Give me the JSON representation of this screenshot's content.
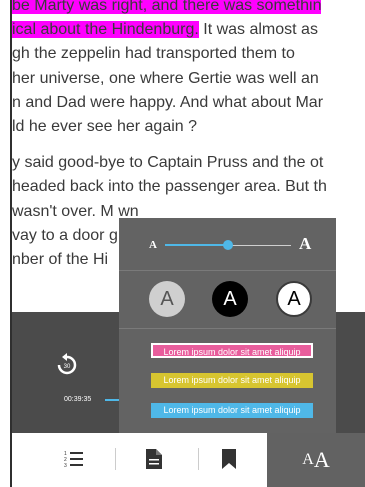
{
  "book_text": {
    "lines": [
      {
        "hl": "be Marty was right, and there was somethin",
        "rest": ""
      },
      {
        "hl": "ical about the Hindenburg.",
        "rest": " It was almost as"
      },
      {
        "hl": "",
        "rest": "gh the zeppelin had transported them to"
      },
      {
        "hl": "",
        "rest": "her universe, one where Gertie was well an"
      },
      {
        "hl": "",
        "rest": "n and Dad were happy. And what about Mar"
      },
      {
        "hl": "",
        "rest": "ld he ever see her again ?"
      },
      {
        "hl": "",
        "rest": "y said good-bye to Captain Pruss and the ot"
      },
      {
        "hl": "",
        "rest": "headed back into the passenger area. But th"
      },
      {
        "hl": "",
        "rest": "wasn't over. M                              wn"
      },
      {
        "hl": "",
        "rest": "vay to a door                             g"
      },
      {
        "hl": "",
        "rest": "nber of the Hi"
      }
    ]
  },
  "player": {
    "replay_seconds": "30",
    "time": "00:39:35",
    "progress_fraction": 0.1
  },
  "font_panel": {
    "size_small_label": "A",
    "size_large_label": "A",
    "size_level": 0.5,
    "themes": [
      {
        "label": "A",
        "name": "gray"
      },
      {
        "label": "A",
        "name": "dark"
      },
      {
        "label": "A",
        "name": "light"
      }
    ],
    "highlight_options": [
      {
        "label": "Lorem ipsum dolor sit amet aliquip",
        "color": "#e85d9c"
      },
      {
        "label": "Lorem ipsum dolor sit amet aliquip",
        "color": "#d7c530"
      },
      {
        "label": "Lorem ipsum dolor sit amet aliquip",
        "color": "#4fb8e8"
      }
    ]
  },
  "toolbar": {
    "icons": [
      "table-of-contents-icon",
      "document-icon",
      "bookmark-icon"
    ],
    "active_label": "AA"
  },
  "colors": {
    "highlight_magenta": "#ff00ff",
    "accent_blue": "#4fb8e8",
    "panel_bg": "#636363"
  }
}
